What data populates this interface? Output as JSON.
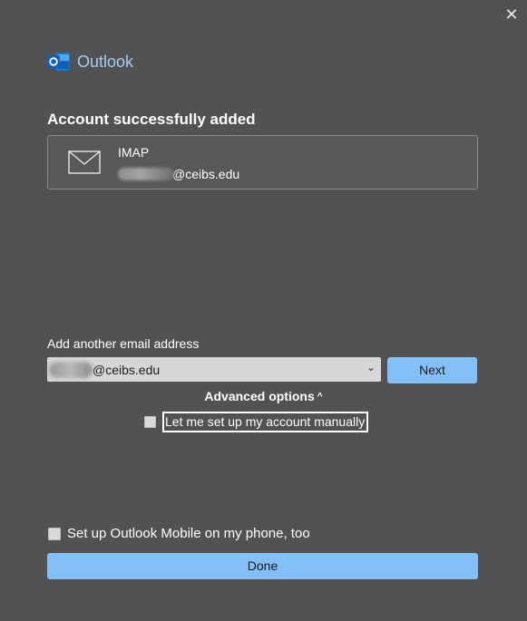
{
  "window": {
    "close_glyph": "✕"
  },
  "brand": {
    "name": "Outlook",
    "logo_icon": "outlook-logo-icon",
    "accent": "#a9cbf5"
  },
  "section": {
    "title": "Account successfully added"
  },
  "account": {
    "icon": "envelope-icon",
    "type": "IMAP",
    "email_visible": "@ceibs.edu"
  },
  "add_email": {
    "label": "Add another email address",
    "select_value_visible": "@ceibs.edu",
    "chevron": "⌄",
    "next_label": "Next"
  },
  "advanced": {
    "label": "Advanced options",
    "caret": "^",
    "manual_setup_label": "Let me set up my account manually",
    "manual_setup_checked": false
  },
  "mobile": {
    "label": "Set up Outlook Mobile on my phone, too",
    "checked": false
  },
  "footer": {
    "done_label": "Done"
  },
  "colors": {
    "background": "#525252",
    "primary_button": "#83c0f7"
  }
}
